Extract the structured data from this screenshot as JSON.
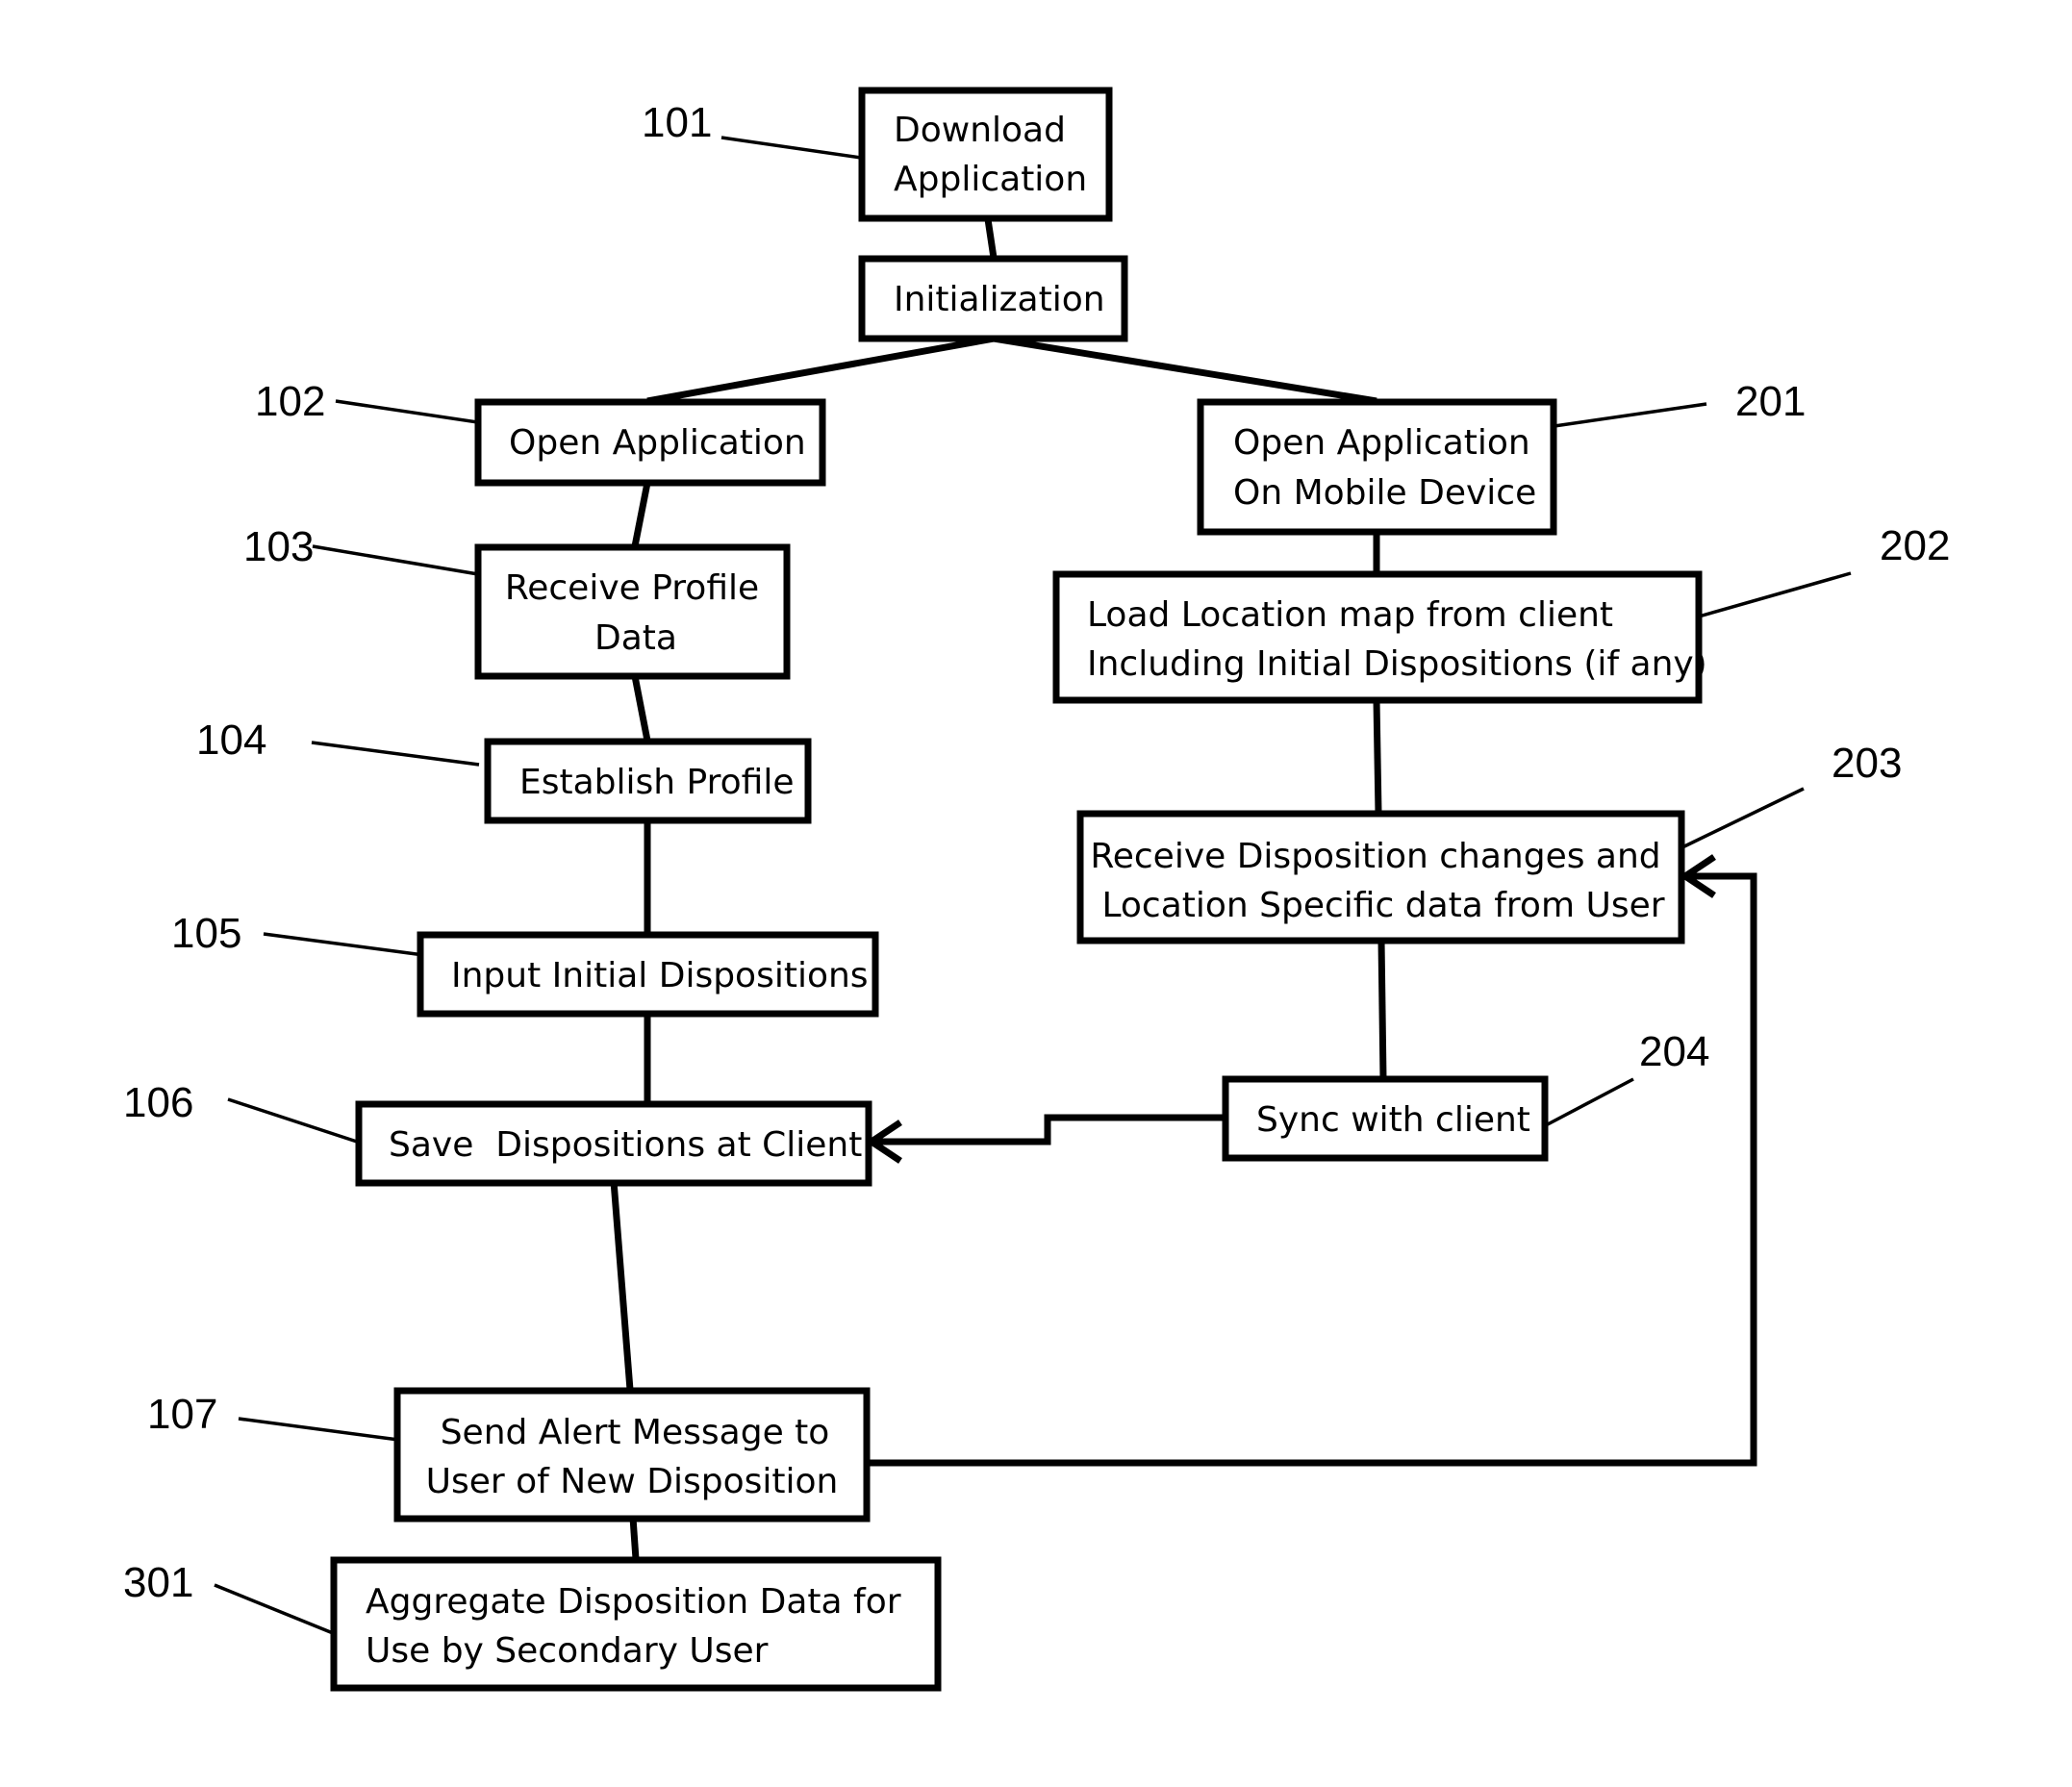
{
  "diagram": {
    "type": "flowchart",
    "nodes": [
      {
        "id": "download",
        "ref": "101",
        "lines": [
          "Download",
          "Application"
        ]
      },
      {
        "id": "init",
        "ref": "",
        "lines": [
          "Initialization"
        ]
      },
      {
        "id": "open-app",
        "ref": "102",
        "lines": [
          "Open Application"
        ]
      },
      {
        "id": "receive-profile",
        "ref": "103",
        "lines": [
          "Receive Profile",
          "Data"
        ]
      },
      {
        "id": "establish-profile",
        "ref": "104",
        "lines": [
          "Establish Profile"
        ]
      },
      {
        "id": "input-dispositions",
        "ref": "105",
        "lines": [
          "Input Initial Dispositions"
        ]
      },
      {
        "id": "save-dispositions",
        "ref": "106",
        "lines": [
          "Save  Dispositions at Client"
        ]
      },
      {
        "id": "send-alert",
        "ref": "107",
        "lines": [
          "Send Alert Message to",
          "User of New Disposition"
        ]
      },
      {
        "id": "aggregate",
        "ref": "301",
        "lines": [
          "Aggregate Disposition Data for",
          "Use by Secondary User"
        ]
      },
      {
        "id": "open-mobile",
        "ref": "201",
        "lines": [
          "Open Application",
          "On Mobile Device"
        ]
      },
      {
        "id": "load-map",
        "ref": "202",
        "lines": [
          "Load Location map from client",
          "Including Initial Dispositions (if any)"
        ]
      },
      {
        "id": "receive-changes",
        "ref": "203",
        "lines": [
          "Receive Disposition changes and",
          "Location Specific data from User"
        ]
      },
      {
        "id": "sync",
        "ref": "204",
        "lines": [
          "Sync with client"
        ]
      }
    ],
    "edges": [
      {
        "from": "download",
        "to": "init"
      },
      {
        "from": "init",
        "to": "open-app"
      },
      {
        "from": "init",
        "to": "open-mobile"
      },
      {
        "from": "open-app",
        "to": "receive-profile"
      },
      {
        "from": "receive-profile",
        "to": "establish-profile"
      },
      {
        "from": "establish-profile",
        "to": "input-dispositions"
      },
      {
        "from": "input-dispositions",
        "to": "save-dispositions"
      },
      {
        "from": "save-dispositions",
        "to": "send-alert"
      },
      {
        "from": "send-alert",
        "to": "aggregate"
      },
      {
        "from": "open-mobile",
        "to": "load-map"
      },
      {
        "from": "load-map",
        "to": "receive-changes"
      },
      {
        "from": "receive-changes",
        "to": "sync"
      },
      {
        "from": "sync",
        "to": "save-dispositions",
        "arrow": true
      },
      {
        "from": "send-alert",
        "to": "receive-changes",
        "arrow": true
      }
    ]
  }
}
